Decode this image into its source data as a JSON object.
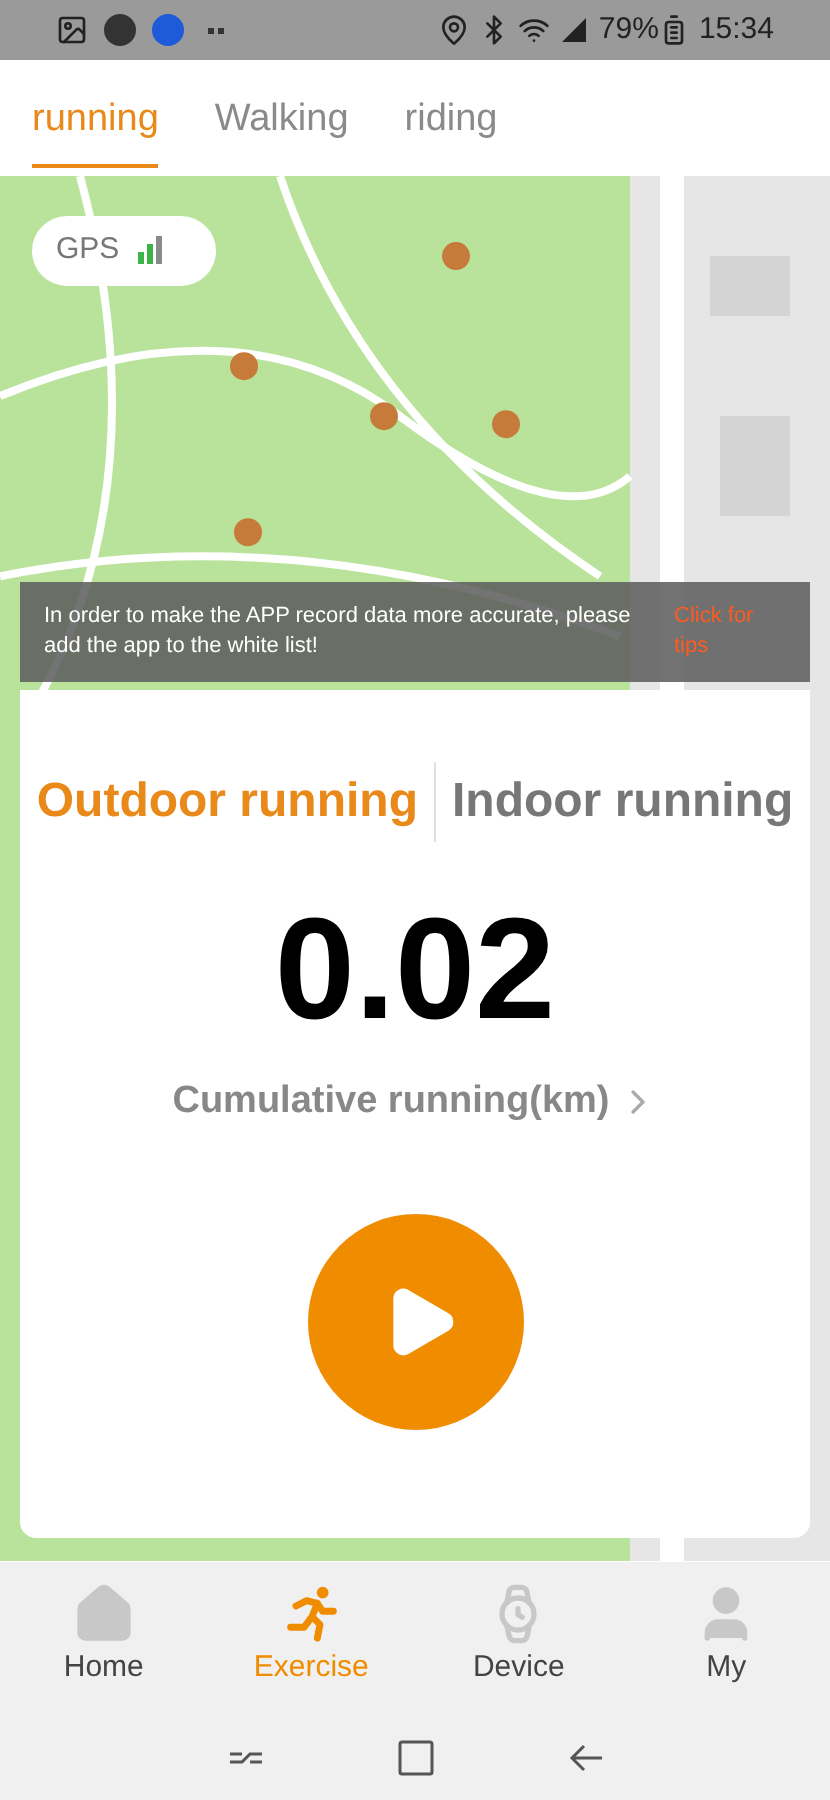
{
  "status_bar": {
    "battery": "79%",
    "time": "15:34"
  },
  "tabs": [
    {
      "label": "running",
      "selected": true
    },
    {
      "label": "Walking",
      "selected": false
    },
    {
      "label": "riding",
      "selected": false
    }
  ],
  "map": {
    "gps": {
      "label": "GPS"
    }
  },
  "notice": {
    "text": "In order to make the APP record data more accurate, please add the app to the white list!",
    "link": "Click for tips"
  },
  "mode_tabs": [
    {
      "label": "Outdoor running",
      "selected": true
    },
    {
      "label": "Indoor running",
      "selected": false
    }
  ],
  "distance": {
    "value": "0.02",
    "label": "Cumulative running(km)"
  },
  "bottom_nav": [
    {
      "label": "Home",
      "selected": false
    },
    {
      "label": "Exercise",
      "selected": true
    },
    {
      "label": "Device",
      "selected": false
    },
    {
      "label": "My",
      "selected": false
    }
  ]
}
